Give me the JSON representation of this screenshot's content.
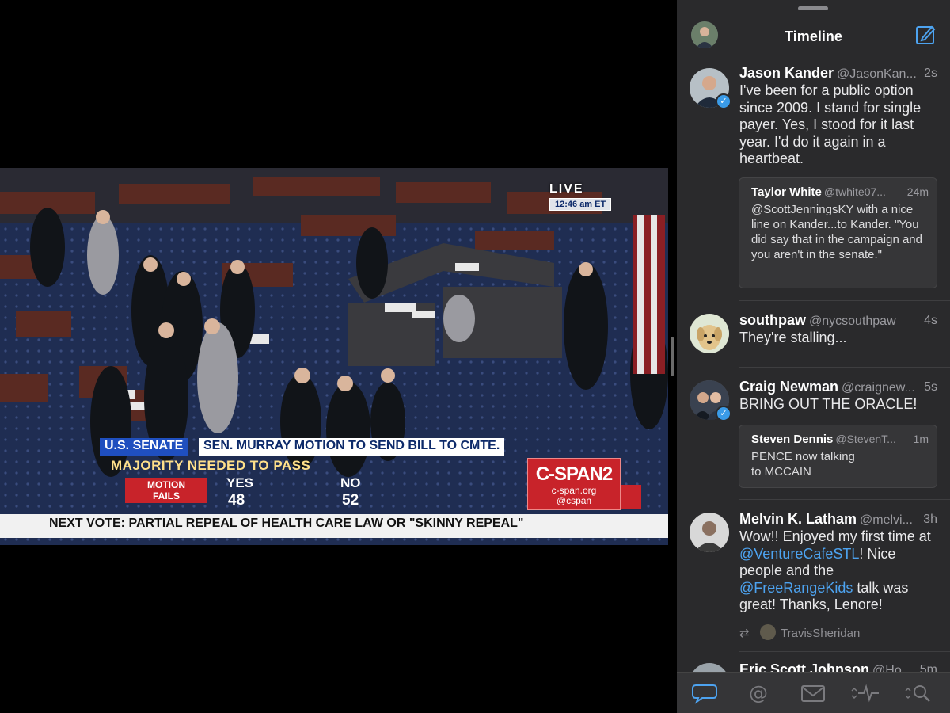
{
  "video": {
    "live_label": "LIVE",
    "time_label": "12:46 am ET",
    "chyron": {
      "network": "U.S. SENATE",
      "headline": "SEN. MURRAY MOTION TO SEND BILL TO CMTE.",
      "subline": "MAJORITY NEEDED TO PASS",
      "result_line1": "MOTION",
      "result_line2": "FAILS",
      "yes_label": "YES",
      "yes_count": "48",
      "no_label": "NO",
      "no_count": "52",
      "logo": "C-SPAN2",
      "site": "c-span.org",
      "social": "@cspan",
      "next_vote": "NEXT VOTE: PARTIAL REPEAL OF HEALTH CARE LAW OR \"SKINNY REPEAL\""
    }
  },
  "app": {
    "nav_title": "Timeline",
    "tweets": [
      {
        "name": "Jason Kander",
        "handle": "@JasonKan...",
        "time": "2s",
        "verified": true,
        "text": "I've been for a public option since 2009. I stand for single payer. Yes, I stood for it last year. I'd do it again in a heartbeat.",
        "quote": {
          "name": "Taylor White",
          "handle": "@twhite07...",
          "time": "24m",
          "text": "@ScottJenningsKY with a nice line on Kander...to Kander.  \"You did say that in the campaign and you aren't in the senate.\""
        }
      },
      {
        "name": "southpaw",
        "handle": "@nycsouthpaw",
        "time": "4s",
        "verified": false,
        "text": "They're stalling..."
      },
      {
        "name": "Craig Newman",
        "handle": "@craignew...",
        "time": "5s",
        "verified": true,
        "text": "BRING OUT THE ORACLE!",
        "quote": {
          "name": "Steven Dennis",
          "handle": "@StevenT...",
          "time": "1m",
          "text": "PENCE now talking to MCCAIN"
        }
      },
      {
        "name": "Melvin K. Latham",
        "handle": "@melvi...",
        "time": "3h",
        "verified": false,
        "text_parts": [
          "Wow!! Enjoyed my first time at ",
          "@VentureCafeSTL",
          "! Nice people and the ",
          "@FreeRangeKids",
          " talk was great! Thanks, Lenore!"
        ],
        "retweeted_by": "TravisSheridan"
      },
      {
        "name": "Eric Scott Johnson",
        "handle": "@Ho...",
        "time": "5m"
      }
    ],
    "tabs": [
      "timeline-tab",
      "mentions-tab",
      "messages-tab",
      "activity-tab",
      "search-tab"
    ]
  }
}
